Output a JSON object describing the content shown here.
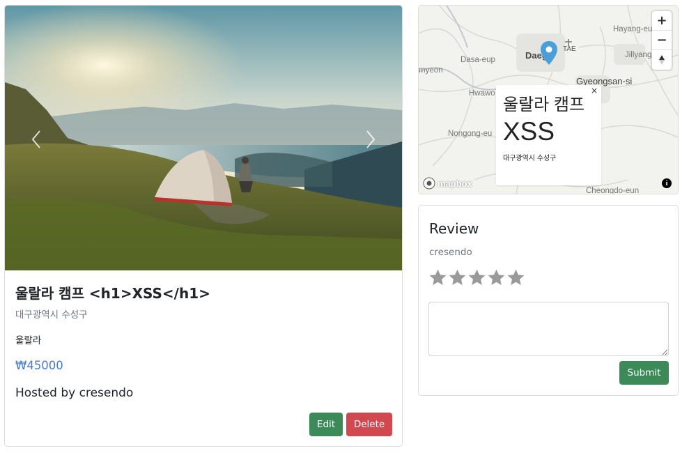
{
  "campground": {
    "title": "울랄라 캠프 <h1>XSS</h1>",
    "location": "대구광역시 수성구",
    "description": "울랄라",
    "price": "₩45000",
    "hosted_by": "Hosted by cresendo",
    "edit_label": "Edit",
    "delete_label": "Delete",
    "image_icon": "campsite-photo"
  },
  "map": {
    "labels": {
      "daegu": "Daegu",
      "tae": "TAE",
      "hayang": "Hayang-eu",
      "jillyang": "Jillyang",
      "dasa": "Dasa-eup",
      "gyeongsan": "Gyeongsan-si",
      "hwawon": "Hwawo",
      "nongong": "Nongong-eu",
      "cheongdo": "Cheongdo-eun",
      "myeon": "myeon"
    },
    "popup": {
      "name": "울랄라 캠프",
      "xss": "XSS",
      "location": "대구광역시 수성구",
      "close": "×"
    },
    "zoom_in": "+",
    "zoom_out": "−",
    "logo_text": "mapbox",
    "info": "i",
    "marker_color": "#4a9fd8"
  },
  "review": {
    "title": "Review",
    "username": "cresendo",
    "rating": 0,
    "max_rating": 5,
    "textarea_value": "",
    "submit_label": "Submit"
  },
  "colors": {
    "success": "#3c8a57",
    "danger": "#d1484f",
    "price": "#4a79d4",
    "muted": "#6c757d"
  }
}
